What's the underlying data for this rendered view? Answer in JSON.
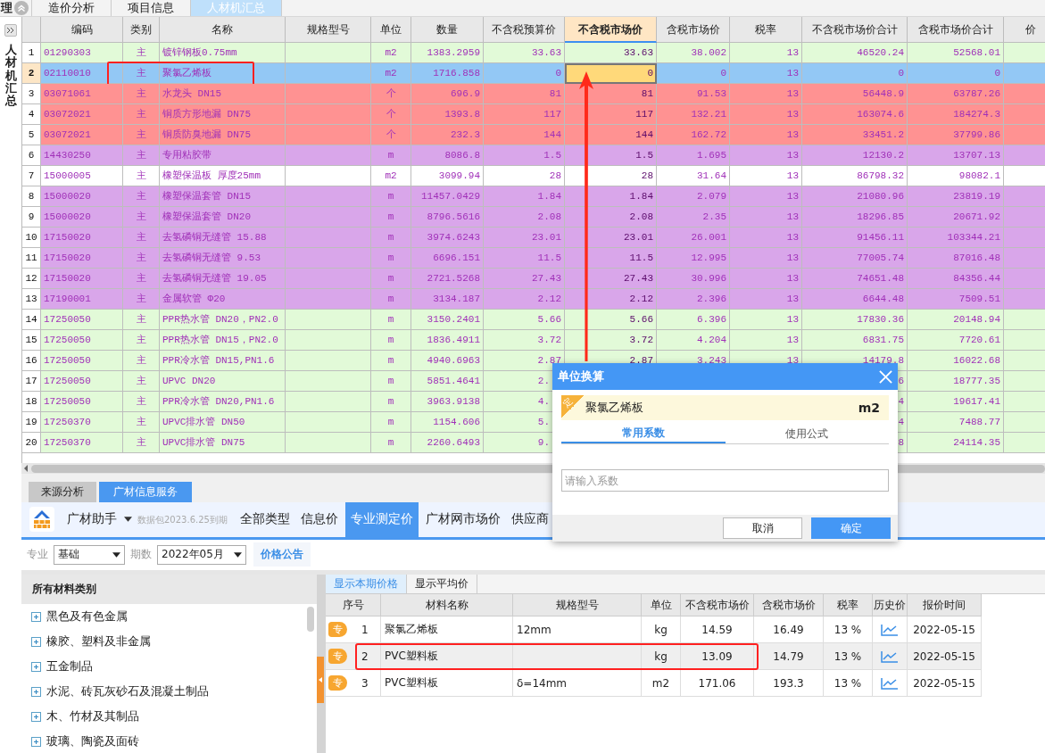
{
  "top_tabs": {
    "fragment": "理",
    "tabs": [
      {
        "label": "造价分析",
        "selected": false
      },
      {
        "label": "项目信息",
        "selected": false
      },
      {
        "label": "人材机汇总",
        "selected": true
      }
    ]
  },
  "sidebar": {
    "title": "人材机汇总"
  },
  "table": {
    "columns": [
      {
        "label": "编码",
        "selected": false
      },
      {
        "label": "类别",
        "selected": false
      },
      {
        "label": "名称",
        "selected": false
      },
      {
        "label": "规格型号",
        "selected": false
      },
      {
        "label": "单位",
        "selected": false
      },
      {
        "label": "数量",
        "selected": false
      },
      {
        "label": "不含税预算价",
        "selected": false
      },
      {
        "label": "不含税市场价",
        "selected": true
      },
      {
        "label": "含税市场价",
        "selected": false
      },
      {
        "label": "税率",
        "selected": false
      },
      {
        "label": "不含税市场价合计",
        "selected": false
      },
      {
        "label": "含税市场价合计",
        "selected": false
      },
      {
        "label": "价",
        "selected": false
      }
    ],
    "rows": [
      {
        "num": "1",
        "color": "#e2fad8",
        "selected": false,
        "marked": false,
        "cells": [
          "01290303",
          "主",
          "镀锌钢板0.75mm",
          null,
          "m2",
          "1383.2959",
          "33.63",
          "33.63",
          "38.002",
          "13",
          "46520.24",
          "52568.01"
        ]
      },
      {
        "num": "2",
        "color": "#93c8f5",
        "selected": true,
        "marked": true,
        "cells": [
          "02110010",
          "主",
          "聚氯乙烯板",
          null,
          "m2",
          "1716.858",
          "0",
          "0",
          "0",
          "13",
          "0",
          "0"
        ]
      },
      {
        "num": "3",
        "color": "#ff9292",
        "selected": false,
        "marked": false,
        "cells": [
          "03071061",
          "主",
          "水龙头 DN15",
          null,
          "个",
          "696.9",
          "81",
          "81",
          "91.53",
          "13",
          "56448.9",
          "63787.26"
        ]
      },
      {
        "num": "4",
        "color": "#ff9292",
        "selected": false,
        "marked": false,
        "cells": [
          "03072021",
          "主",
          "铜质方形地漏 DN75",
          null,
          "个",
          "1393.8",
          "117",
          "117",
          "132.21",
          "13",
          "163074.6",
          "184274.3"
        ]
      },
      {
        "num": "5",
        "color": "#ff9292",
        "selected": false,
        "marked": false,
        "cells": [
          "03072021",
          "主",
          "铜质防臭地漏 DN75",
          null,
          "个",
          "232.3",
          "144",
          "144",
          "162.72",
          "13",
          "33451.2",
          "37799.86"
        ]
      },
      {
        "num": "6",
        "color": "#d9a6ea",
        "selected": false,
        "marked": false,
        "cells": [
          "14430250",
          "主",
          "专用粘胶带",
          null,
          "m",
          "8086.8",
          "1.5",
          "1.5",
          "1.695",
          "13",
          "12130.2",
          "13707.13"
        ]
      },
      {
        "num": "7",
        "color": "#ffffff",
        "selected": false,
        "marked": false,
        "cells": [
          "15000005",
          "主",
          "橡塑保温板 厚度25mm",
          null,
          "m2",
          "3099.94",
          "28",
          "28",
          "31.64",
          "13",
          "86798.32",
          "98082.1"
        ]
      },
      {
        "num": "8",
        "color": "#d9a6ea",
        "selected": false,
        "marked": false,
        "cells": [
          "15000020",
          "主",
          "橡塑保温套管 DN15",
          null,
          "m",
          "11457.0429",
          "1.84",
          "1.84",
          "2.079",
          "13",
          "21080.96",
          "23819.19"
        ]
      },
      {
        "num": "9",
        "color": "#d9a6ea",
        "selected": false,
        "marked": false,
        "cells": [
          "15000020",
          "主",
          "橡塑保温套管 DN20",
          null,
          "m",
          "8796.5616",
          "2.08",
          "2.08",
          "2.35",
          "13",
          "18296.85",
          "20671.92"
        ]
      },
      {
        "num": "10",
        "color": "#d9a6ea",
        "selected": false,
        "marked": false,
        "cells": [
          "17150020",
          "主",
          "去氢磷铜无缝管 15.88",
          null,
          "m",
          "3974.6243",
          "23.01",
          "23.01",
          "26.001",
          "13",
          "91456.11",
          "103344.21"
        ]
      },
      {
        "num": "11",
        "color": "#d9a6ea",
        "selected": false,
        "marked": false,
        "cells": [
          "17150020",
          "主",
          "去氢磷铜无缝管 9.53",
          null,
          "m",
          "6696.151",
          "11.5",
          "11.5",
          "12.995",
          "13",
          "77005.74",
          "87016.48"
        ]
      },
      {
        "num": "12",
        "color": "#d9a6ea",
        "selected": false,
        "marked": false,
        "cells": [
          "17150020",
          "主",
          "去氢磷铜无缝管 19.05",
          null,
          "m",
          "2721.5268",
          "27.43",
          "27.43",
          "30.996",
          "13",
          "74651.48",
          "84356.44"
        ]
      },
      {
        "num": "13",
        "color": "#d9a6ea",
        "selected": false,
        "marked": false,
        "cells": [
          "17190001",
          "主",
          "金属软管 Φ20",
          null,
          "m",
          "3134.187",
          "2.12",
          "2.12",
          "2.396",
          "13",
          "6644.48",
          "7509.51"
        ]
      },
      {
        "num": "14",
        "color": "#e2fad8",
        "selected": false,
        "marked": false,
        "cells": [
          "17250050",
          "主",
          "PPR热水管 DN20，PN2.0",
          null,
          "m",
          "3150.2401",
          "5.66",
          "5.66",
          "6.396",
          "13",
          "17830.36",
          "20148.94"
        ]
      },
      {
        "num": "15",
        "color": "#e2fad8",
        "selected": false,
        "marked": false,
        "cells": [
          "17250050",
          "主",
          "PPR热水管 DN15，PN2.0",
          null,
          "m",
          "1836.4911",
          "3.72",
          "3.72",
          "4.204",
          "13",
          "6831.75",
          "7720.61"
        ]
      },
      {
        "num": "16",
        "color": "#e2fad8",
        "selected": false,
        "marked": false,
        "cells": [
          "17250050",
          "主",
          "PPR冷水管 DN15,PN1.6",
          null,
          "m",
          "4940.6963",
          "2.87",
          "2.87",
          "3.243",
          "13",
          "14179.8",
          "16022.68"
        ]
      },
      {
        "num": "17",
        "color": "#e2fad8",
        "selected": false,
        "marked": false,
        "cells": [
          "17250050",
          "主",
          "UPVC DN20",
          null,
          "m",
          "5851.4641",
          "2.",
          null,
          null,
          null,
          "6",
          "18777.35"
        ]
      },
      {
        "num": "18",
        "color": "#e2fad8",
        "selected": false,
        "marked": false,
        "cells": [
          "17250050",
          "主",
          "PPR冷水管 DN20,PN1.6",
          null,
          "m",
          "3963.9138",
          "4.",
          null,
          null,
          null,
          "4",
          "19617.41"
        ]
      },
      {
        "num": "19",
        "color": "#e2fad8",
        "selected": false,
        "marked": false,
        "cells": [
          "17250370",
          "主",
          "UPVC排水管 DN50",
          null,
          "m",
          "1154.606",
          "5.",
          null,
          null,
          null,
          "4",
          "7488.77"
        ]
      },
      {
        "num": "20",
        "color": "#e2fad8",
        "selected": false,
        "marked": false,
        "cells": [
          "17250370",
          "主",
          "UPVC排水管 DN75",
          null,
          "m",
          "2260.6493",
          "9.",
          null,
          null,
          null,
          "8",
          "24114.35"
        ]
      }
    ]
  },
  "bottom": {
    "tabs": [
      {
        "label": "来源分析",
        "selected": false
      },
      {
        "label": "广材信息服务",
        "selected": true
      }
    ],
    "toolbar": {
      "product": "广材助手",
      "package_note": "数据包2023.6.25到期",
      "nav": [
        {
          "label": "全部类型",
          "selected": false
        },
        {
          "label": "信息价",
          "selected": false
        },
        {
          "label": "专业测定价",
          "selected": true
        },
        {
          "label": "广材网市场价",
          "selected": false
        },
        {
          "label": "供应商",
          "selected": false
        }
      ]
    },
    "filters": {
      "major_label": "专业",
      "major": "基础",
      "period_label": "期数",
      "period": "2022年05月",
      "notice_button": "价格公告"
    },
    "categories": {
      "title": "所有材料类别",
      "items": [
        "黑色及有色金属",
        "橡胶、塑料及非金属",
        "五金制品",
        "水泥、砖瓦灰砂石及混凝土制品",
        "木、竹材及其制品",
        "玻璃、陶瓷及面砖"
      ]
    },
    "price_tabs": [
      {
        "label": "显示本期价格",
        "selected": true
      },
      {
        "label": "显示平均价",
        "selected": false
      }
    ],
    "price_table": {
      "columns": [
        "序号",
        "材料名称",
        "规格型号",
        "单位",
        "不含税市场价",
        "含税市场价",
        "税率",
        "历史价",
        "报价时间"
      ],
      "rows": [
        {
          "badge": "专",
          "num": "1",
          "name": "聚氯乙烯板",
          "spec": "12mm",
          "unit": "kg",
          "price": "14.59",
          "tax_price": "16.49",
          "rate": "13 %",
          "date": "2022-05-15",
          "selected": false,
          "marked": false
        },
        {
          "badge": "专",
          "num": "2",
          "name": "PVC塑料板",
          "unit": "kg",
          "price": "13.09",
          "tax_price": "14.79",
          "rate": "13 %",
          "date": "2022-05-15",
          "selected": true,
          "marked": true
        },
        {
          "badge": "专",
          "num": "3",
          "name": "PVC塑料板",
          "spec": "δ=14mm",
          "unit": "m2",
          "price": "171.06",
          "tax_price": "193.3",
          "rate": "13 %",
          "date": "2022-05-15",
          "selected": false,
          "marked": false
        }
      ]
    }
  },
  "dialog": {
    "title": "单位换算",
    "badge": "定",
    "material": "聚氯乙烯板",
    "unit": "m2",
    "tabs": [
      {
        "label": "常用系数",
        "selected": true
      },
      {
        "label": "使用公式",
        "selected": false
      }
    ],
    "input_placeholder": "请输入系数",
    "buttons": [
      {
        "label": "取消",
        "kind": "secondary"
      },
      {
        "label": "确定",
        "kind": "primary"
      }
    ]
  }
}
